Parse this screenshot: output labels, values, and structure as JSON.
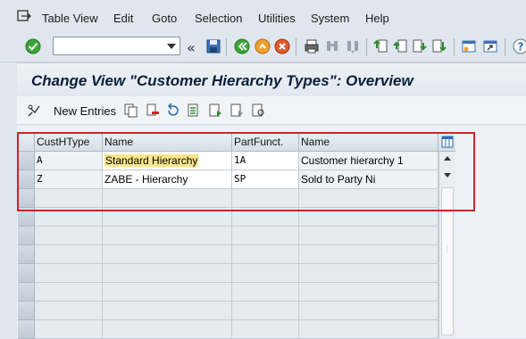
{
  "menu": {
    "items": [
      "Table View",
      "Edit",
      "Goto",
      "Selection",
      "Utilities",
      "System",
      "Help"
    ]
  },
  "toolbar": {
    "command_field": {
      "value": "",
      "placeholder": ""
    },
    "back_arrows": "«"
  },
  "title": "Change View \"Customer Hierarchy Types\": Overview",
  "app_toolbar": {
    "new_entries_label": "New Entries"
  },
  "table": {
    "columns": [
      "CustHType",
      "Name",
      "PartFunct.",
      "Name"
    ],
    "rows": [
      {
        "type": "A",
        "name": "Standard Hierarchy",
        "partner_function": "1A",
        "pf_name": "Customer hierarchy 1"
      },
      {
        "type": "Z",
        "name": "ZABE - Hierarchy",
        "partner_function": "SP",
        "pf_name": "Sold to Party Ni"
      }
    ]
  },
  "colors": {
    "highlight_frame": "#d1232a",
    "text_selection": "#f9e58a",
    "background": "#dfe6ee"
  }
}
